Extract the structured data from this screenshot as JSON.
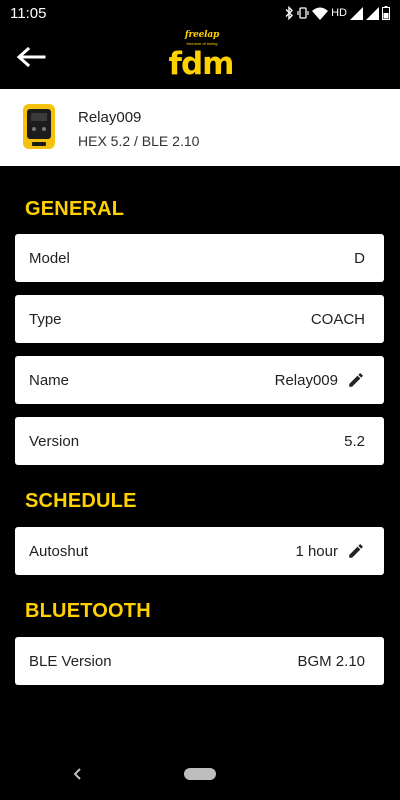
{
  "status_bar": {
    "time": "11:05",
    "network_label": "HD",
    "icons": [
      "bluetooth-icon",
      "vibrate-icon",
      "wifi-icon",
      "signal-icon",
      "signal-icon",
      "battery-icon"
    ]
  },
  "app_bar": {
    "back_icon": "arrow-left-icon",
    "logo_brand": "freelap",
    "logo_tagline": "freedom of timing",
    "logo_text": "fdm"
  },
  "device": {
    "name": "Relay009",
    "firmware": "HEX 5.2 / BLE 2.10",
    "image_icon": "relay-device-icon"
  },
  "sections": {
    "general": {
      "title": "GENERAL",
      "rows": [
        {
          "label": "Model",
          "value": "D",
          "editable": false
        },
        {
          "label": "Type",
          "value": "COACH",
          "editable": false
        },
        {
          "label": "Name",
          "value": "Relay009",
          "editable": true
        },
        {
          "label": "Version",
          "value": "5.2",
          "editable": false
        }
      ]
    },
    "schedule": {
      "title": "SCHEDULE",
      "rows": [
        {
          "label": "Autoshut",
          "value": "1 hour",
          "editable": true
        }
      ]
    },
    "bluetooth": {
      "title": "BLUETOOTH",
      "rows": [
        {
          "label": "BLE Version",
          "value": "BGM 2.10",
          "editable": false
        }
      ]
    }
  },
  "colors": {
    "background": "#000000",
    "accent": "#ffd100",
    "card": "#ffffff",
    "text_dark": "#222222"
  },
  "nav_bar": {
    "back_icon": "chevron-left-icon",
    "home_icon": "home-pill-icon"
  }
}
